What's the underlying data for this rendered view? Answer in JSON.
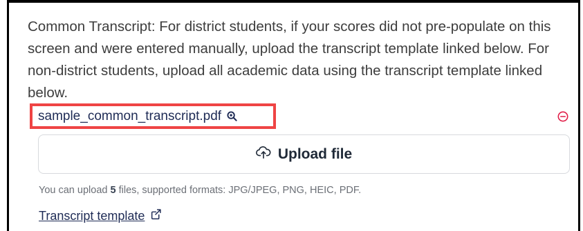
{
  "description": "Common Transcript: For district students, if your scores did not pre-populate on this screen and were entered manually, upload the transcript template linked below. For non-district students, upload all academic data using the transcript template linked below.",
  "file": {
    "name": "sample_common_transcript.pdf",
    "preview_icon": "magnifier-icon",
    "remove_icon": "minus-circle-icon"
  },
  "upload": {
    "label": "Upload file",
    "icon": "cloud-upload-icon"
  },
  "hint": {
    "prefix": "You can upload ",
    "count": "5",
    "suffix": " files, supported formats: JPG/JPEG, PNG, HEIC, PDF."
  },
  "template_link": {
    "label": "Transcript template",
    "icon": "external-link-icon"
  },
  "colors": {
    "highlight_border": "#ef4444",
    "remove_icon": "#e11d48",
    "link": "#1e2b55"
  }
}
